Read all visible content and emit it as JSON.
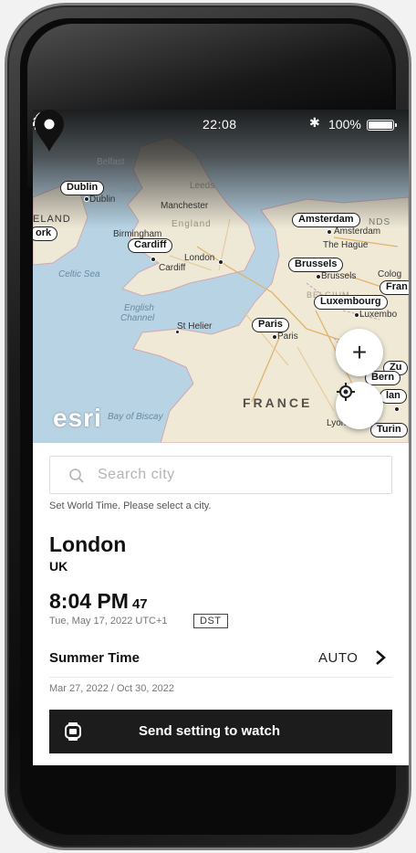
{
  "status_bar": {
    "time": "22:08",
    "battery": "100%"
  },
  "map": {
    "attribution": "esri",
    "labels": {
      "belfast": "Belfast",
      "dublin": "Dublin",
      "dublin_small": "Dublin",
      "irish_sea": "Sea",
      "leeds": "Leeds",
      "manchester": "Manchester",
      "ireland": "ELAND",
      "york": "ork",
      "birmingham": "Birmingham",
      "cardiff": "Cardiff",
      "cardiff_small": "Cardiff",
      "england": "England",
      "london": "London",
      "amsterdam": "Amsterdam",
      "amsterdam_small": "Amsterdam",
      "nds": "NDS",
      "the_hague": "The Hague",
      "brussels": "Brussels",
      "brussels_small": "Brussels",
      "cologne": "Colog",
      "celtic_sea": "Celtic Sea",
      "english_channel_1": "English",
      "english_channel_2": "Channel",
      "st_helier": "St Helier",
      "paris": "Paris",
      "paris_small": "Paris",
      "belgium": "BELGIUM",
      "luxembourg": "Luxembourg",
      "luxembourg_small": "Luxembo",
      "frankfurt": "Fran",
      "zurich": "Zu",
      "bern": "Bern",
      "milan": "lan",
      "turin": "Turin",
      "france": "FRANCE",
      "lyon": "Lyon",
      "bay_of_biscay": "Bay of Biscay"
    },
    "zoom_in_symbol": "+",
    "icons": {
      "sunrise": "sunrise-icon",
      "settings": "gear-icon",
      "pin": "map-pin-icon",
      "locate": "locate-icon"
    }
  },
  "search": {
    "placeholder": "Search city"
  },
  "hint": "Set World Time. Please select a city.",
  "selection": {
    "city": "London",
    "country": "UK",
    "time": "8:04 PM",
    "seconds": "47",
    "date": "Tue, May 17, 2022 UTC+1",
    "dst_badge": "DST"
  },
  "summer_time": {
    "label": "Summer Time",
    "mode": "AUTO",
    "range": "Mar 27, 2022 / Oct 30, 2022"
  },
  "send_button": {
    "label": "Send setting to watch",
    "icon": "watch-icon"
  },
  "colors": {
    "button_bg": "#1c1c1c",
    "sea": "#b7d3e4",
    "land": "#efe9d8"
  }
}
